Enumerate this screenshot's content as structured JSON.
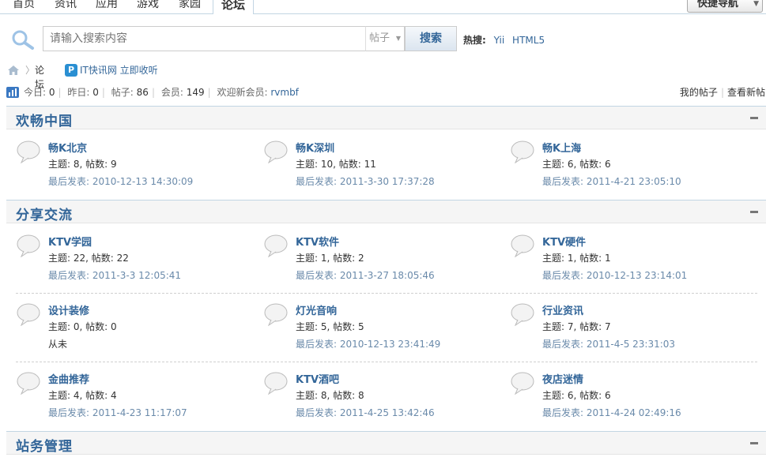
{
  "nav": {
    "tabs": [
      "首页",
      "资讯",
      "应用",
      "游戏",
      "家园",
      "论坛"
    ],
    "active_tab": "论坛",
    "quick_nav": "快捷导航"
  },
  "search": {
    "placeholder": "请输入搜索内容",
    "type": "帖子",
    "button": "搜索",
    "hot_label": "热搜:",
    "hot_items": [
      "Yii",
      "HTML5"
    ]
  },
  "breadcrumb": {
    "forum": "论坛",
    "app_text": "IT快讯网 立即收听"
  },
  "stats": {
    "today_label": "今日:",
    "today": "0",
    "yesterday_label": "昨日:",
    "yesterday": "0",
    "posts_label": "帖子:",
    "posts": "86",
    "members_label": "会员:",
    "members": "149",
    "new_member_label": "欢迎新会员:",
    "new_member": "rvmbf",
    "my_posts": "我的帖子",
    "new_posts": "查看新帖"
  },
  "categories": [
    {
      "title": "欢畅中国",
      "forums": [
        {
          "name": "畅K北京",
          "counts": "主题: 8, 帖数: 9",
          "last": "最后发表: 2010-12-13 14:30:09"
        },
        {
          "name": "畅K深圳",
          "counts": "主题: 10, 帖数: 11",
          "last": "最后发表: 2011-3-30 17:37:28"
        },
        {
          "name": "畅K上海",
          "counts": "主题: 6, 帖数: 6",
          "last": "最后发表: 2011-4-21 23:05:10"
        }
      ]
    },
    {
      "title": "分享交流",
      "forums": [
        {
          "name": "KTV学园",
          "counts": "主题: 22, 帖数: 22",
          "last": "最后发表: 2011-3-3 12:05:41"
        },
        {
          "name": "KTV软件",
          "counts": "主题: 1, 帖数: 2",
          "last": "最后发表: 2011-3-27 18:05:46"
        },
        {
          "name": "KTV硬件",
          "counts": "主题: 1, 帖数: 1",
          "last": "最后发表: 2010-12-13 23:14:01"
        },
        {
          "name": "设计装修",
          "counts": "主题: 0, 帖数: 0",
          "last": "从未"
        },
        {
          "name": "灯光音响",
          "counts": "主题: 5, 帖数: 5",
          "last": "最后发表: 2010-12-13 23:41:49"
        },
        {
          "name": "行业资讯",
          "counts": "主题: 7, 帖数: 7",
          "last": "最后发表: 2011-4-5 23:31:03"
        },
        {
          "name": "金曲推荐",
          "counts": "主题: 4, 帖数: 4",
          "last": "最后发表: 2011-4-23 11:17:07"
        },
        {
          "name": "KTV酒吧",
          "counts": "主题: 8, 帖数: 8",
          "last": "最后发表: 2011-4-25 13:42:46"
        },
        {
          "name": "夜店迷情",
          "counts": "主题: 6, 帖数: 6",
          "last": "最后发表: 2011-4-24 02:49:16"
        }
      ]
    },
    {
      "title": "站务管理",
      "forums": []
    }
  ],
  "colors": {
    "link": "#336699",
    "border": "#c2d5e3",
    "header_bg": "#f5f5f5",
    "last_post": "#6a8aaa"
  }
}
